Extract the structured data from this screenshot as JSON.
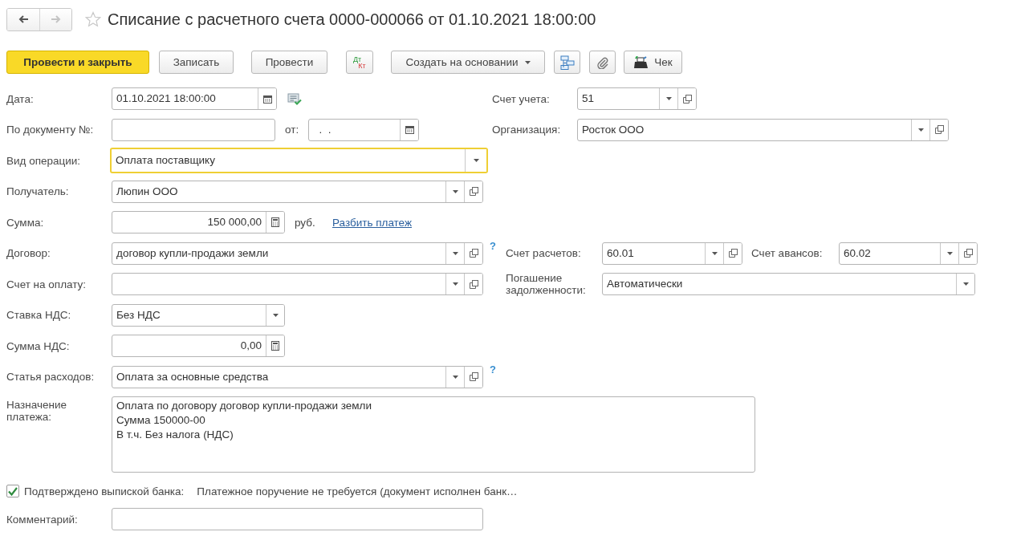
{
  "header": {
    "nav": [
      {
        "kind": "back",
        "disabled": false
      },
      {
        "kind": "forward",
        "disabled": true
      }
    ],
    "favorite": false,
    "title": "Списание с расчетного счета 0000-000066 от 01.10.2021 18:00:00"
  },
  "toolbar": [
    {
      "kind": "primary",
      "label": "Провести и закрыть"
    },
    {
      "kind": "default",
      "label": "Записать"
    },
    {
      "kind": "default",
      "label": "Провести"
    },
    {
      "kind": "dtkt",
      "top": "Дт",
      "bottom": "Кт"
    },
    {
      "kind": "menu",
      "label": "Создать на основании"
    },
    {
      "kind": "structure"
    },
    {
      "kind": "attach"
    },
    {
      "kind": "receipt",
      "label": "Чек"
    }
  ],
  "form": [
    {
      "items": [
        {
          "kind": "label",
          "text": "Дата:"
        },
        {
          "kind": "date",
          "value": "01.10.2021 18:00:00",
          "focused": false
        },
        {
          "kind": "status_icon"
        },
        {
          "kind": "label",
          "text": "Счет учета:"
        },
        {
          "kind": "ref",
          "value": "51",
          "focused": false
        }
      ]
    },
    {
      "items": [
        {
          "kind": "label",
          "text": "По документу №:"
        },
        {
          "kind": "text",
          "focused": false
        },
        {
          "kind": "label",
          "text": "от:"
        },
        {
          "kind": "date",
          "value": "  .  .",
          "focused": false
        },
        {
          "kind": "label",
          "text": "Организация:"
        },
        {
          "kind": "ref",
          "value": "Росток ООО",
          "focused": false
        }
      ]
    },
    {
      "items": [
        {
          "kind": "label",
          "text": "Вид операции:"
        },
        {
          "kind": "combo",
          "value": "Оплата поставщику",
          "focused": true
        }
      ]
    },
    {
      "items": [
        {
          "kind": "label",
          "text": "Получатель:"
        },
        {
          "kind": "ref",
          "value": "Люпин ООО",
          "focused": false
        }
      ]
    },
    {
      "items": [
        {
          "kind": "label",
          "text": "Сумма:"
        },
        {
          "kind": "money",
          "value": "150 000,00",
          "focused": false
        },
        {
          "kind": "unit",
          "text": "руб."
        },
        {
          "kind": "link",
          "text": "Разбить платеж"
        }
      ]
    },
    {
      "items": [
        {
          "kind": "label",
          "text": "Договор:"
        },
        {
          "kind": "ref",
          "value": "договор купли-продажи земли",
          "focused": false
        },
        {
          "kind": "help",
          "text": "?"
        },
        {
          "kind": "label",
          "text": "Счет расчетов:"
        },
        {
          "kind": "ref",
          "value": "60.01",
          "focused": false
        },
        {
          "kind": "label",
          "text": "Счет авансов:"
        },
        {
          "kind": "ref",
          "value": "60.02",
          "focused": false
        }
      ]
    },
    {
      "items": [
        {
          "kind": "label",
          "text": "Счет на оплату:"
        },
        {
          "kind": "ref",
          "focused": false
        },
        {
          "kind": "label",
          "text": "Погашение задолженности:"
        },
        {
          "kind": "combo",
          "value": "Автоматически",
          "focused": false
        }
      ]
    },
    {
      "items": [
        {
          "kind": "label",
          "text": "Ставка НДС:"
        },
        {
          "kind": "combo",
          "value": "Без НДС",
          "focused": false
        }
      ]
    },
    {
      "items": [
        {
          "kind": "label",
          "text": "Сумма НДС:"
        },
        {
          "kind": "money",
          "value": "0,00",
          "focused": false
        }
      ]
    },
    {
      "items": [
        {
          "kind": "label",
          "text": "Статья расходов:"
        },
        {
          "kind": "ref",
          "value": "Оплата за основные средства",
          "focused": false
        },
        {
          "kind": "help",
          "text": "?"
        }
      ]
    },
    {
      "items": [
        {
          "kind": "label",
          "text": "Назначение платежа:"
        },
        {
          "kind": "textarea",
          "lines": [
            "Оплата по договору договор купли-продажи земли",
            "Сумма 150000-00",
            "В т.ч. Без налога (НДС)"
          ],
          "focused": false
        }
      ]
    },
    {
      "items": [
        {
          "kind": "checkbox",
          "text": "Подтверждено выпиской банка:",
          "checked": true
        },
        {
          "kind": "note",
          "text": "Платежное поручение не требуется (документ исполнен банк…"
        }
      ]
    },
    {
      "items": [
        {
          "kind": "label",
          "text": "Комментарий:"
        },
        {
          "kind": "text",
          "focused": false
        }
      ]
    }
  ]
}
